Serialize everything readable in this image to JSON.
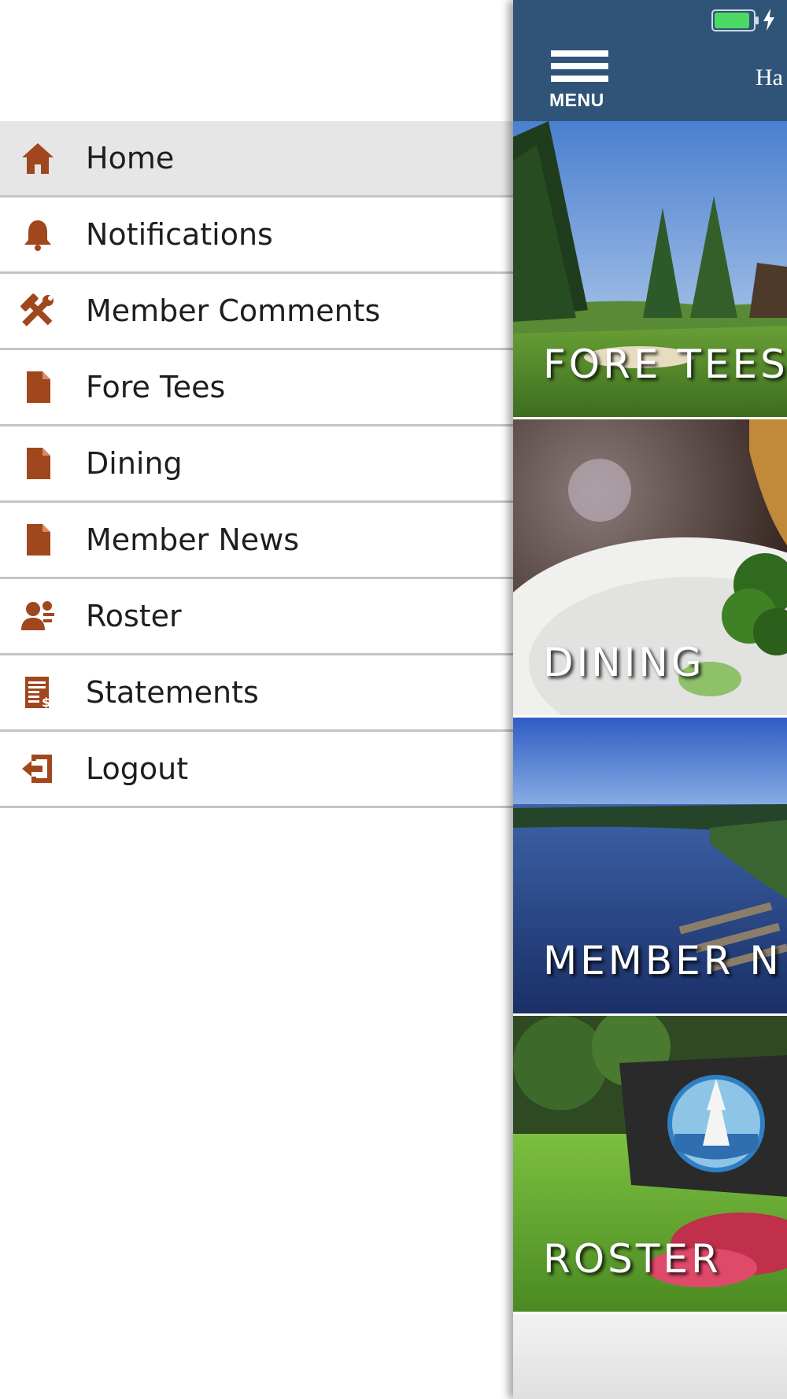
{
  "drawer": {
    "items": [
      {
        "label": "Home",
        "icon": "home-icon",
        "active": true
      },
      {
        "label": "Notifications",
        "icon": "bell-icon"
      },
      {
        "label": "Member Comments",
        "icon": "tools-icon"
      },
      {
        "label": "Fore Tees",
        "icon": "document-icon"
      },
      {
        "label": "Dining",
        "icon": "document-icon"
      },
      {
        "label": "Member News",
        "icon": "document-icon"
      },
      {
        "label": "Roster",
        "icon": "person-icon"
      },
      {
        "label": "Statements",
        "icon": "statement-icon"
      },
      {
        "label": "Logout",
        "icon": "logout-icon"
      }
    ],
    "icon_color": "#a0471e"
  },
  "header": {
    "menu_label": "MENU",
    "title_fragment": "Ha",
    "bg_color": "#2f5478"
  },
  "status": {
    "battery_level": 1.0,
    "charging": true,
    "battery_color": "#4cd964"
  },
  "tiles": [
    {
      "label": "FORE TEES"
    },
    {
      "label": "DINING"
    },
    {
      "label": "MEMBER N"
    },
    {
      "label": "ROSTER"
    }
  ]
}
